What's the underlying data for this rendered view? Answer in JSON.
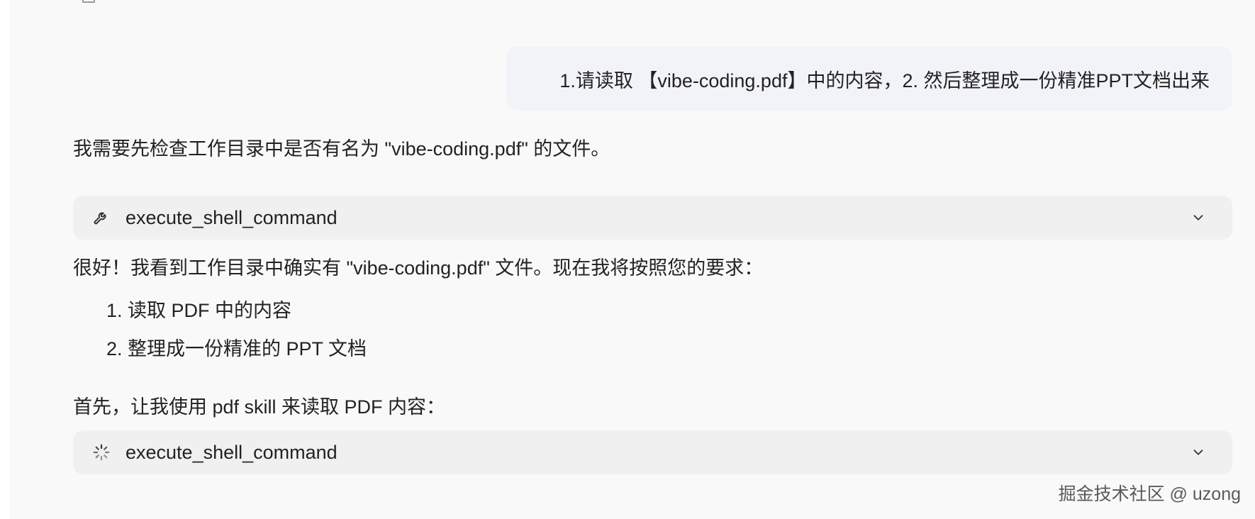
{
  "user_message": "1.请读取 【vibe-coding.pdf】中的内容，2. 然后整理成一份精准PPT文档出来",
  "assistant": {
    "line1": "我需要先检查工作目录中是否有名为 \"vibe-coding.pdf\" 的文件。",
    "tool_call_1": {
      "name": "execute_shell_command",
      "icon": "wrench-icon",
      "status": "done"
    },
    "line2": "很好！我看到工作目录中确实有 \"vibe-coding.pdf\" 文件。现在我将按照您的要求：",
    "steps": [
      "1. 读取 PDF 中的内容",
      "2. 整理成一份精准的 PPT 文档"
    ],
    "line3": "首先，让我使用 pdf skill 来读取 PDF 内容：",
    "tool_call_2": {
      "name": "execute_shell_command",
      "icon": "spinner-icon",
      "status": "running"
    }
  },
  "watermark": "掘金技术社区 @ uzong",
  "colors": {
    "background": "#f9f9f9",
    "user_bubble": "#f2f3f8",
    "tool_card": "#f0f0f0",
    "text": "#222222"
  }
}
